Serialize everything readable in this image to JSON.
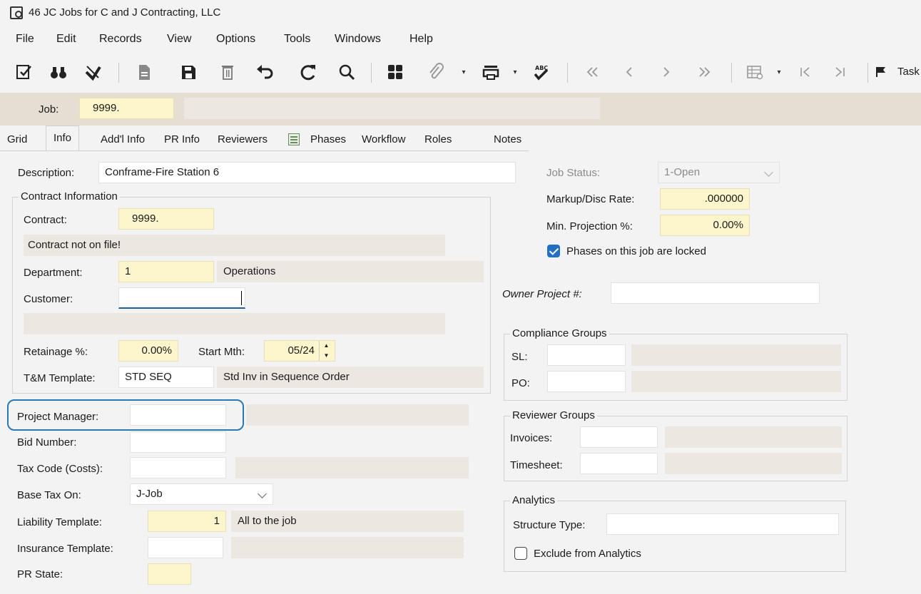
{
  "window": {
    "title": "46 JC Jobs for C and J Contracting, LLC"
  },
  "menu": [
    "File",
    "Edit",
    "Records",
    "View",
    "Options",
    "Tools",
    "Windows",
    "Help"
  ],
  "toolbar": {
    "task_label": "Task"
  },
  "job": {
    "label": "Job:",
    "value": "9999.",
    "description": ""
  },
  "tabs": [
    {
      "label": "Grid"
    },
    {
      "label": "Info",
      "active": true
    },
    {
      "label": "Add'l Info"
    },
    {
      "label": "PR Info"
    },
    {
      "label": "Reviewers"
    },
    {
      "label": "Phases"
    },
    {
      "label": "Workflow"
    },
    {
      "label": "Roles"
    },
    {
      "label": "Notes"
    }
  ],
  "info": {
    "description_label": "Description:",
    "description_value": "Conframe-Fire Station 6",
    "contract_group_title": "Contract Information",
    "contract_label": "Contract:",
    "contract_value": "9999.",
    "contract_status": "Contract not on file!",
    "department_label": "Department:",
    "department_value": "1",
    "department_name": "Operations",
    "customer_label": "Customer:",
    "customer_value": "",
    "customer_name": "",
    "retainage_label": "Retainage %:",
    "retainage_value": "0.00%",
    "start_mth_label": "Start Mth:",
    "start_mth_value": "05/24",
    "tm_template_label": "T&M Template:",
    "tm_template_value": "STD SEQ",
    "tm_template_desc": "Std Inv in Sequence Order",
    "project_manager_label": "Project Manager:",
    "project_manager_value": "",
    "project_manager_name": "",
    "bid_number_label": "Bid Number:",
    "bid_number_value": "",
    "tax_code_label": "Tax Code (Costs):",
    "tax_code_value": "",
    "tax_code_desc": "",
    "base_tax_label": "Base Tax On:",
    "base_tax_value": "J-Job",
    "liability_label": "Liability Template:",
    "liability_value": "1",
    "liability_desc": "All to the job",
    "insurance_label": "Insurance Template:",
    "insurance_value": "",
    "insurance_desc": "",
    "pr_state_label": "PR State:",
    "pr_state_value": ""
  },
  "right": {
    "job_status_label": "Job Status:",
    "job_status_value": "1-Open",
    "markup_label": "Markup/Disc Rate:",
    "markup_value": ".000000",
    "min_proj_label": "Min. Projection %:",
    "min_proj_value": "0.00%",
    "phases_locked_label": "Phases on this job are locked",
    "phases_locked": true,
    "owner_project_label": "Owner Project #:",
    "owner_project_value": "",
    "compliance_title": "Compliance Groups",
    "sl_label": "SL:",
    "sl_value": "",
    "po_label": "PO:",
    "po_value": "",
    "reviewer_title": "Reviewer Groups",
    "invoices_label": "Invoices:",
    "invoices_value": "",
    "timesheet_label": "Timesheet:",
    "timesheet_value": "",
    "analytics_title": "Analytics",
    "structure_type_label": "Structure Type:",
    "structure_type_value": "",
    "exclude_analytics_label": "Exclude from Analytics",
    "exclude_analytics": false
  },
  "colors": {
    "accent": "#1f6fc5",
    "highlight": "#2b78b8",
    "required_field": "#fdf6cc",
    "header_band": "#e6ddd3"
  }
}
